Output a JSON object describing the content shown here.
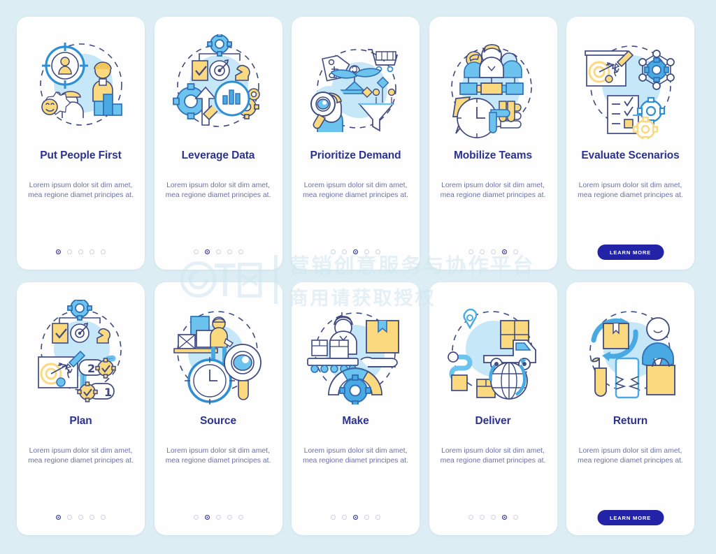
{
  "watermark": {
    "line1": "营销创意服务与协作平台",
    "line2": "商用请获取授权"
  },
  "colors": {
    "page_background": "#dcedf3",
    "card_background": "#fefefe",
    "title": "#2c3291",
    "body_text": "#6b72a8",
    "dot_active": "#2c3291",
    "dot_inactive": "#cfd2e4",
    "button": "#2323a8",
    "button_text": "#ffffff",
    "accent_blue": "#41a5e0",
    "accent_light_blue": "#bfe4f5",
    "accent_yellow": "#fad97f",
    "outline": "#3f4a80"
  },
  "body_text": "Lorem ipsum dolor sit dim amet, mea regione diamet principes at.",
  "button_label": "LEARN MORE",
  "rows": [
    {
      "cards": [
        {
          "title": "Put People First",
          "icon": "people-target-icon",
          "dots": 5,
          "active": 0,
          "button": false
        },
        {
          "title": "Leverage Data",
          "icon": "gears-chart-icon",
          "dots": 5,
          "active": 1,
          "button": false
        },
        {
          "title": "Prioritize Demand",
          "icon": "scales-funnel-icon",
          "dots": 5,
          "active": 2,
          "button": false
        },
        {
          "title": "Mobilize Teams",
          "icon": "team-hands-clock-icon",
          "dots": 5,
          "active": 3,
          "button": false
        },
        {
          "title": "Evaluate Scenarios",
          "icon": "board-network-gears-icon",
          "dots": 0,
          "active": -1,
          "button": true
        }
      ]
    },
    {
      "cards": [
        {
          "title": "Plan",
          "icon": "plan-strategy-icon",
          "dots": 5,
          "active": 0,
          "button": false
        },
        {
          "title": "Source",
          "icon": "source-clock-magnifier-icon",
          "dots": 5,
          "active": 1,
          "button": false
        },
        {
          "title": "Make",
          "icon": "conveyor-gauge-icon",
          "dots": 5,
          "active": 2,
          "button": false
        },
        {
          "title": "Deliver",
          "icon": "truck-globe-icon",
          "dots": 5,
          "active": 3,
          "button": false
        },
        {
          "title": "Return",
          "icon": "return-arrows-icon",
          "dots": 0,
          "active": -1,
          "button": true
        }
      ]
    }
  ]
}
